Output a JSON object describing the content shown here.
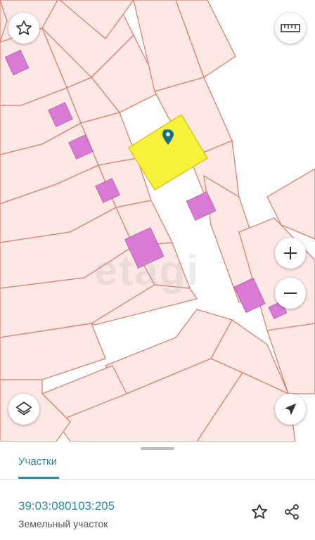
{
  "map": {
    "watermark": "etagi",
    "controls": {
      "favorite": "star-outline-icon",
      "ruler": "ruler-icon",
      "zoom_in": "+",
      "zoom_out": "−",
      "layers": "layers-icon",
      "locate": "navigation-arrow-icon"
    },
    "colors": {
      "parcel_fill": "#fde8e6",
      "parcel_border": "#d9826f",
      "building": "#d97ad4",
      "selected": "#f6f23a",
      "marker": "#1a6f86"
    }
  },
  "sheet": {
    "tab_label": "Участки",
    "parcel": {
      "cadastral_number": "39:03:080103:205",
      "type": "Земельный участок"
    },
    "actions": {
      "favorite": "star-outline-icon",
      "share": "share-icon"
    },
    "accent": "#2a8ca4"
  }
}
